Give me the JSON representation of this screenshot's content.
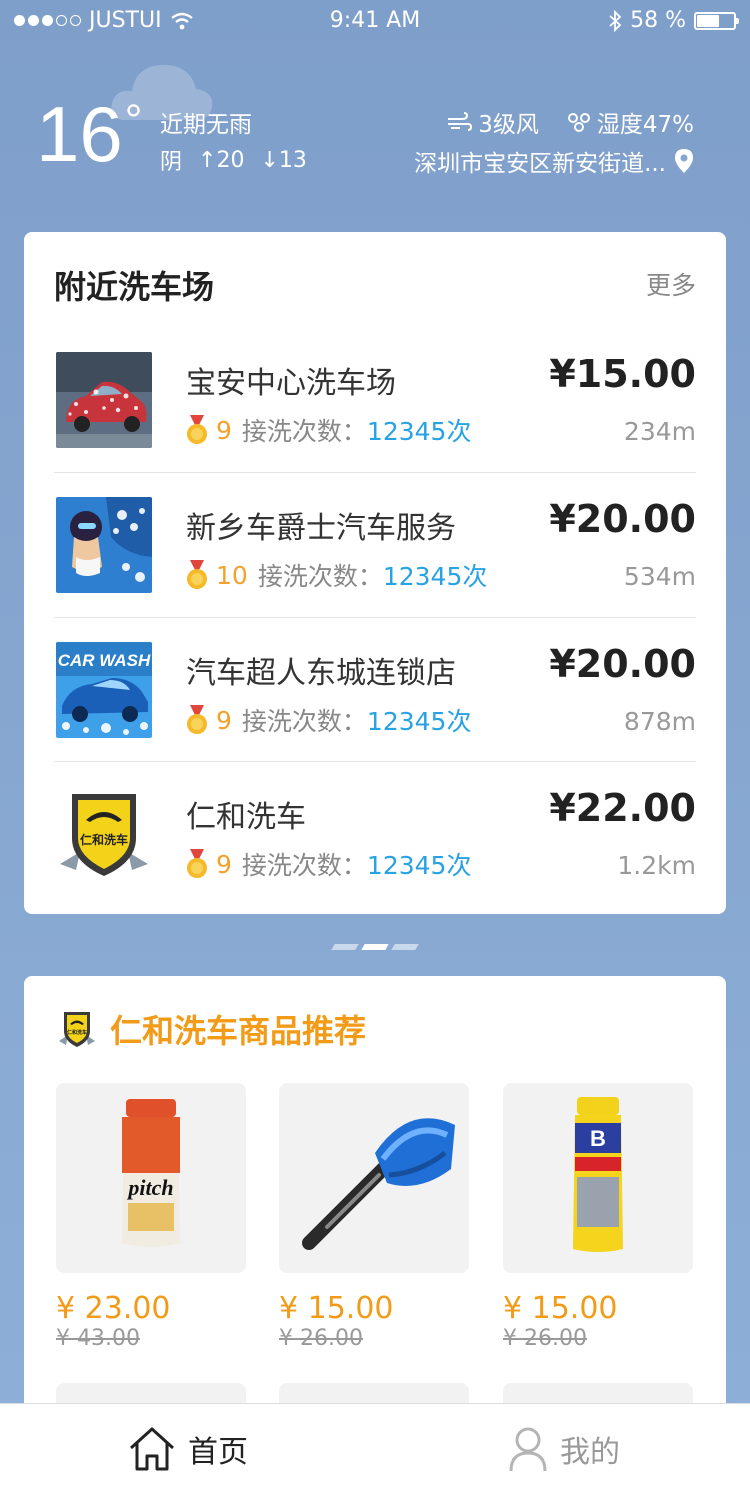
{
  "status_bar": {
    "carrier": "JUSTUI",
    "time": "9:41 AM",
    "battery": "58 %",
    "battery_level": 0.58
  },
  "weather": {
    "temperature": "16",
    "degree_symbol": "°",
    "description": "近期无雨",
    "condition": "阴",
    "high": "↑20",
    "low": "↓13",
    "wind": "3级风",
    "humidity": "湿度47%",
    "location": "深圳市宝安区新安街道..."
  },
  "nearby": {
    "title": "附近洗车场",
    "more_label": "更多",
    "shops": [
      {
        "name": "宝安中心洗车场",
        "rank": "9",
        "count_label": "接洗次数：",
        "count": "12345次",
        "price": "¥15.00",
        "distance": "234m"
      },
      {
        "name": "新乡车爵士汽车服务",
        "rank": "10",
        "count_label": "接洗次数：",
        "count": "12345次",
        "price": "¥20.00",
        "distance": "534m"
      },
      {
        "name": "汽车超人东城连锁店",
        "rank": "9",
        "count_label": "接洗次数：",
        "count": "12345次",
        "price": "¥20.00",
        "distance": "878m"
      },
      {
        "name": "仁和洗车",
        "rank": "9",
        "count_label": "接洗次数：",
        "count": "12345次",
        "price": "¥22.00",
        "distance": "1.2km"
      }
    ],
    "thumb_texts": {
      "carwash": "CAR WASH",
      "renhe": "仁和洗车"
    }
  },
  "goods": {
    "title": "仁和洗车商品推荐",
    "logo_text": "仁和洗车",
    "products": [
      {
        "price": "¥ 23.00",
        "old_price": "¥ 43.00",
        "label": "pitch"
      },
      {
        "price": "¥ 15.00",
        "old_price": "¥ 26.00"
      },
      {
        "price": "¥ 15.00",
        "old_price": "¥ 26.00",
        "label": "B"
      }
    ]
  },
  "tabbar": {
    "home": "首页",
    "me": "我的"
  },
  "colors": {
    "accent_orange": "#f29b19",
    "link_blue": "#27a2e3",
    "background": "#86a6d0"
  }
}
